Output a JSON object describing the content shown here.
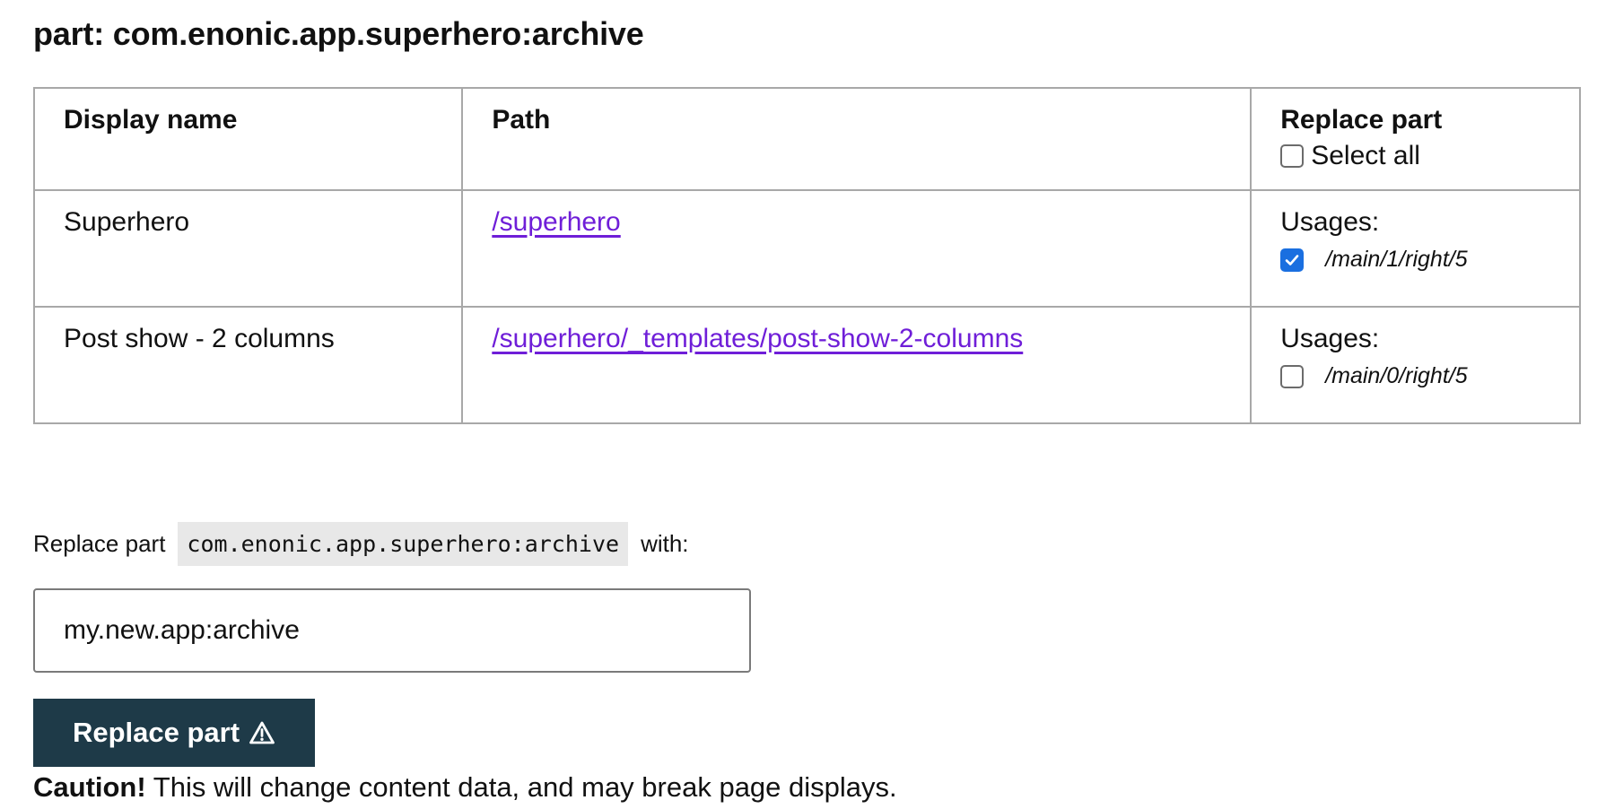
{
  "title": "part: com.enonic.app.superhero:archive",
  "table": {
    "headers": {
      "display_name": "Display name",
      "path": "Path",
      "replace_part": "Replace part",
      "select_all": "Select all"
    },
    "rows": [
      {
        "display_name": "Superhero",
        "path": "/superhero",
        "usages_label": "Usages:",
        "usage": "/main/1/right/5",
        "checked": true
      },
      {
        "display_name": "Post show - 2 columns",
        "path": "/superhero/_templates/post-show-2-columns",
        "usages_label": "Usages:",
        "usage": "/main/0/right/5",
        "checked": false
      }
    ]
  },
  "replace": {
    "prefix": "Replace part",
    "code": "com.enonic.app.superhero:archive",
    "suffix": "with:",
    "input_value": "my.new.app:archive",
    "button_label": "Replace part",
    "button_icon": "warning-triangle-icon"
  },
  "caution": {
    "strong": "Caution!",
    "text": "This will change content data, and may break page displays."
  },
  "colors": {
    "link": "#6f1ed8",
    "button_bg": "#1e3a48",
    "checkbox_checked": "#1a6fe0",
    "code_bg": "#e8e8e8"
  }
}
